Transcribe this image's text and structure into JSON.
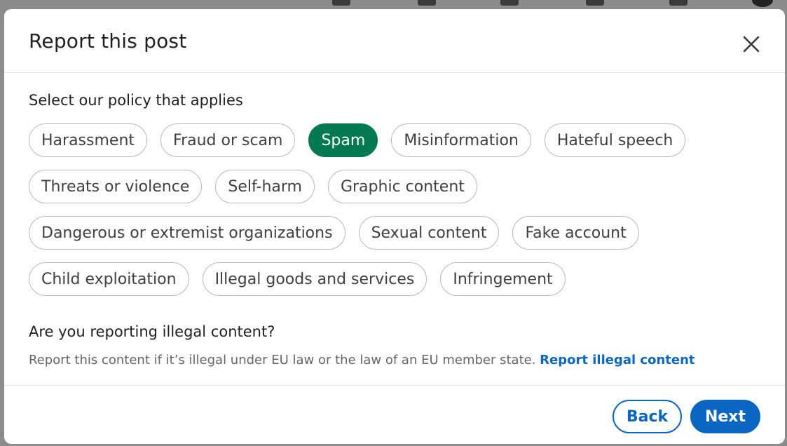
{
  "modal": {
    "title": "Report this post",
    "section_title": "Select our policy that applies",
    "chip_rows": [
      [
        {
          "label": "Harassment",
          "selected": false
        },
        {
          "label": "Fraud or scam",
          "selected": false
        },
        {
          "label": "Spam",
          "selected": true
        },
        {
          "label": "Misinformation",
          "selected": false
        },
        {
          "label": "Hateful speech",
          "selected": false
        }
      ],
      [
        {
          "label": "Threats or violence",
          "selected": false
        },
        {
          "label": "Self-harm",
          "selected": false
        },
        {
          "label": "Graphic content",
          "selected": false
        }
      ],
      [
        {
          "label": "Dangerous or extremist organizations",
          "selected": false
        },
        {
          "label": "Sexual content",
          "selected": false
        },
        {
          "label": "Fake account",
          "selected": false
        }
      ],
      [
        {
          "label": "Child exploitation",
          "selected": false
        },
        {
          "label": "Illegal goods and services",
          "selected": false
        },
        {
          "label": "Infringement",
          "selected": false
        }
      ]
    ],
    "illegal": {
      "question": "Are you reporting illegal content?",
      "description": "Report this content if it’s illegal under EU law or the law of an EU member state. ",
      "link": "Report illegal content"
    },
    "footer": {
      "back_label": "Back",
      "next_label": "Next"
    }
  },
  "colors": {
    "selected_chip": "#057a52",
    "primary": "#0a66c2"
  },
  "icons": {
    "close": "close-icon"
  }
}
